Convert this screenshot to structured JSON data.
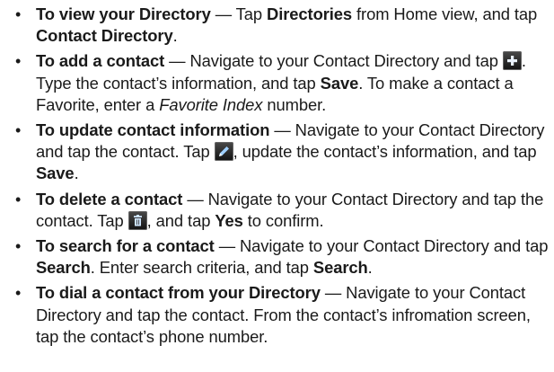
{
  "items": [
    {
      "title": "To view your Directory",
      "t1": " — Tap ",
      "b1": "Directories",
      "t2": " from Home view, and tap ",
      "b2": "Contact Directory",
      "t3": "."
    },
    {
      "title": "To add a contact",
      "t1": " — Navigate to your Contact Directory and tap ",
      "icon": "add-icon",
      "t2": ". Type the contact’s information, and tap ",
      "b1": "Save",
      "t3": ". To make a contact a Favorite, enter a ",
      "i1": "Favorite Index",
      "t4": " number."
    },
    {
      "title": "To update contact information",
      "t1": " — Navigate to your Contact Directory and tap the contact. Tap ",
      "icon": "edit-pencil-icon",
      "t2": ", update the contact’s information, and tap ",
      "b1": "Save",
      "t3": "."
    },
    {
      "title": "To delete a contact",
      "t1": " — Navigate to your Contact Directory and tap the contact. Tap ",
      "icon": "trash-icon",
      "t2": ", and tap ",
      "b1": "Yes",
      "t3": " to confirm."
    },
    {
      "title": "To search for a contact",
      "t1": " — Navigate to your Contact Directory and tap ",
      "b1": "Search",
      "t2": ". Enter search criteria, and tap ",
      "b2": "Search",
      "t3": "."
    },
    {
      "title": "To dial a contact from your Directory",
      "t1": " — Navigate to your Contact Directory and tap the contact. From the contact’s infromation screen, tap the contact’s phone number."
    }
  ],
  "bullet": "•",
  "colors": {
    "icon_add_plus": "#e9f1fb",
    "icon_edit": "#9fd0ff",
    "icon_trash": "#cfe6ff"
  }
}
